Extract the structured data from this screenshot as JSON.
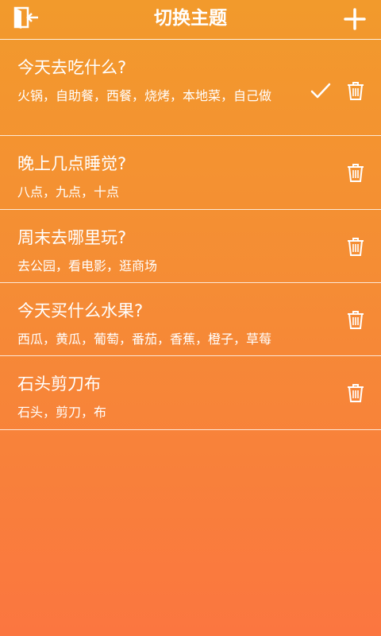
{
  "header": {
    "title": "切换主题"
  },
  "topics": [
    {
      "title": "今天去吃什么?",
      "options": "火锅，自助餐，西餐，烧烤，本地菜，自己做",
      "selected": true
    },
    {
      "title": "晚上几点睡觉?",
      "options": "八点，九点，十点",
      "selected": false
    },
    {
      "title": "周末去哪里玩?",
      "options": "去公园，看电影，逛商场",
      "selected": false
    },
    {
      "title": "今天买什么水果?",
      "options": "西瓜，黄瓜，葡萄，番茄，香蕉，橙子，草莓",
      "selected": false
    },
    {
      "title": "石头剪刀布",
      "options": "石头，剪刀，布",
      "selected": false
    }
  ],
  "icons": {
    "back": "exit-door-icon",
    "add": "plus-icon",
    "selected": "checkmark-icon",
    "delete": "trash-icon"
  }
}
